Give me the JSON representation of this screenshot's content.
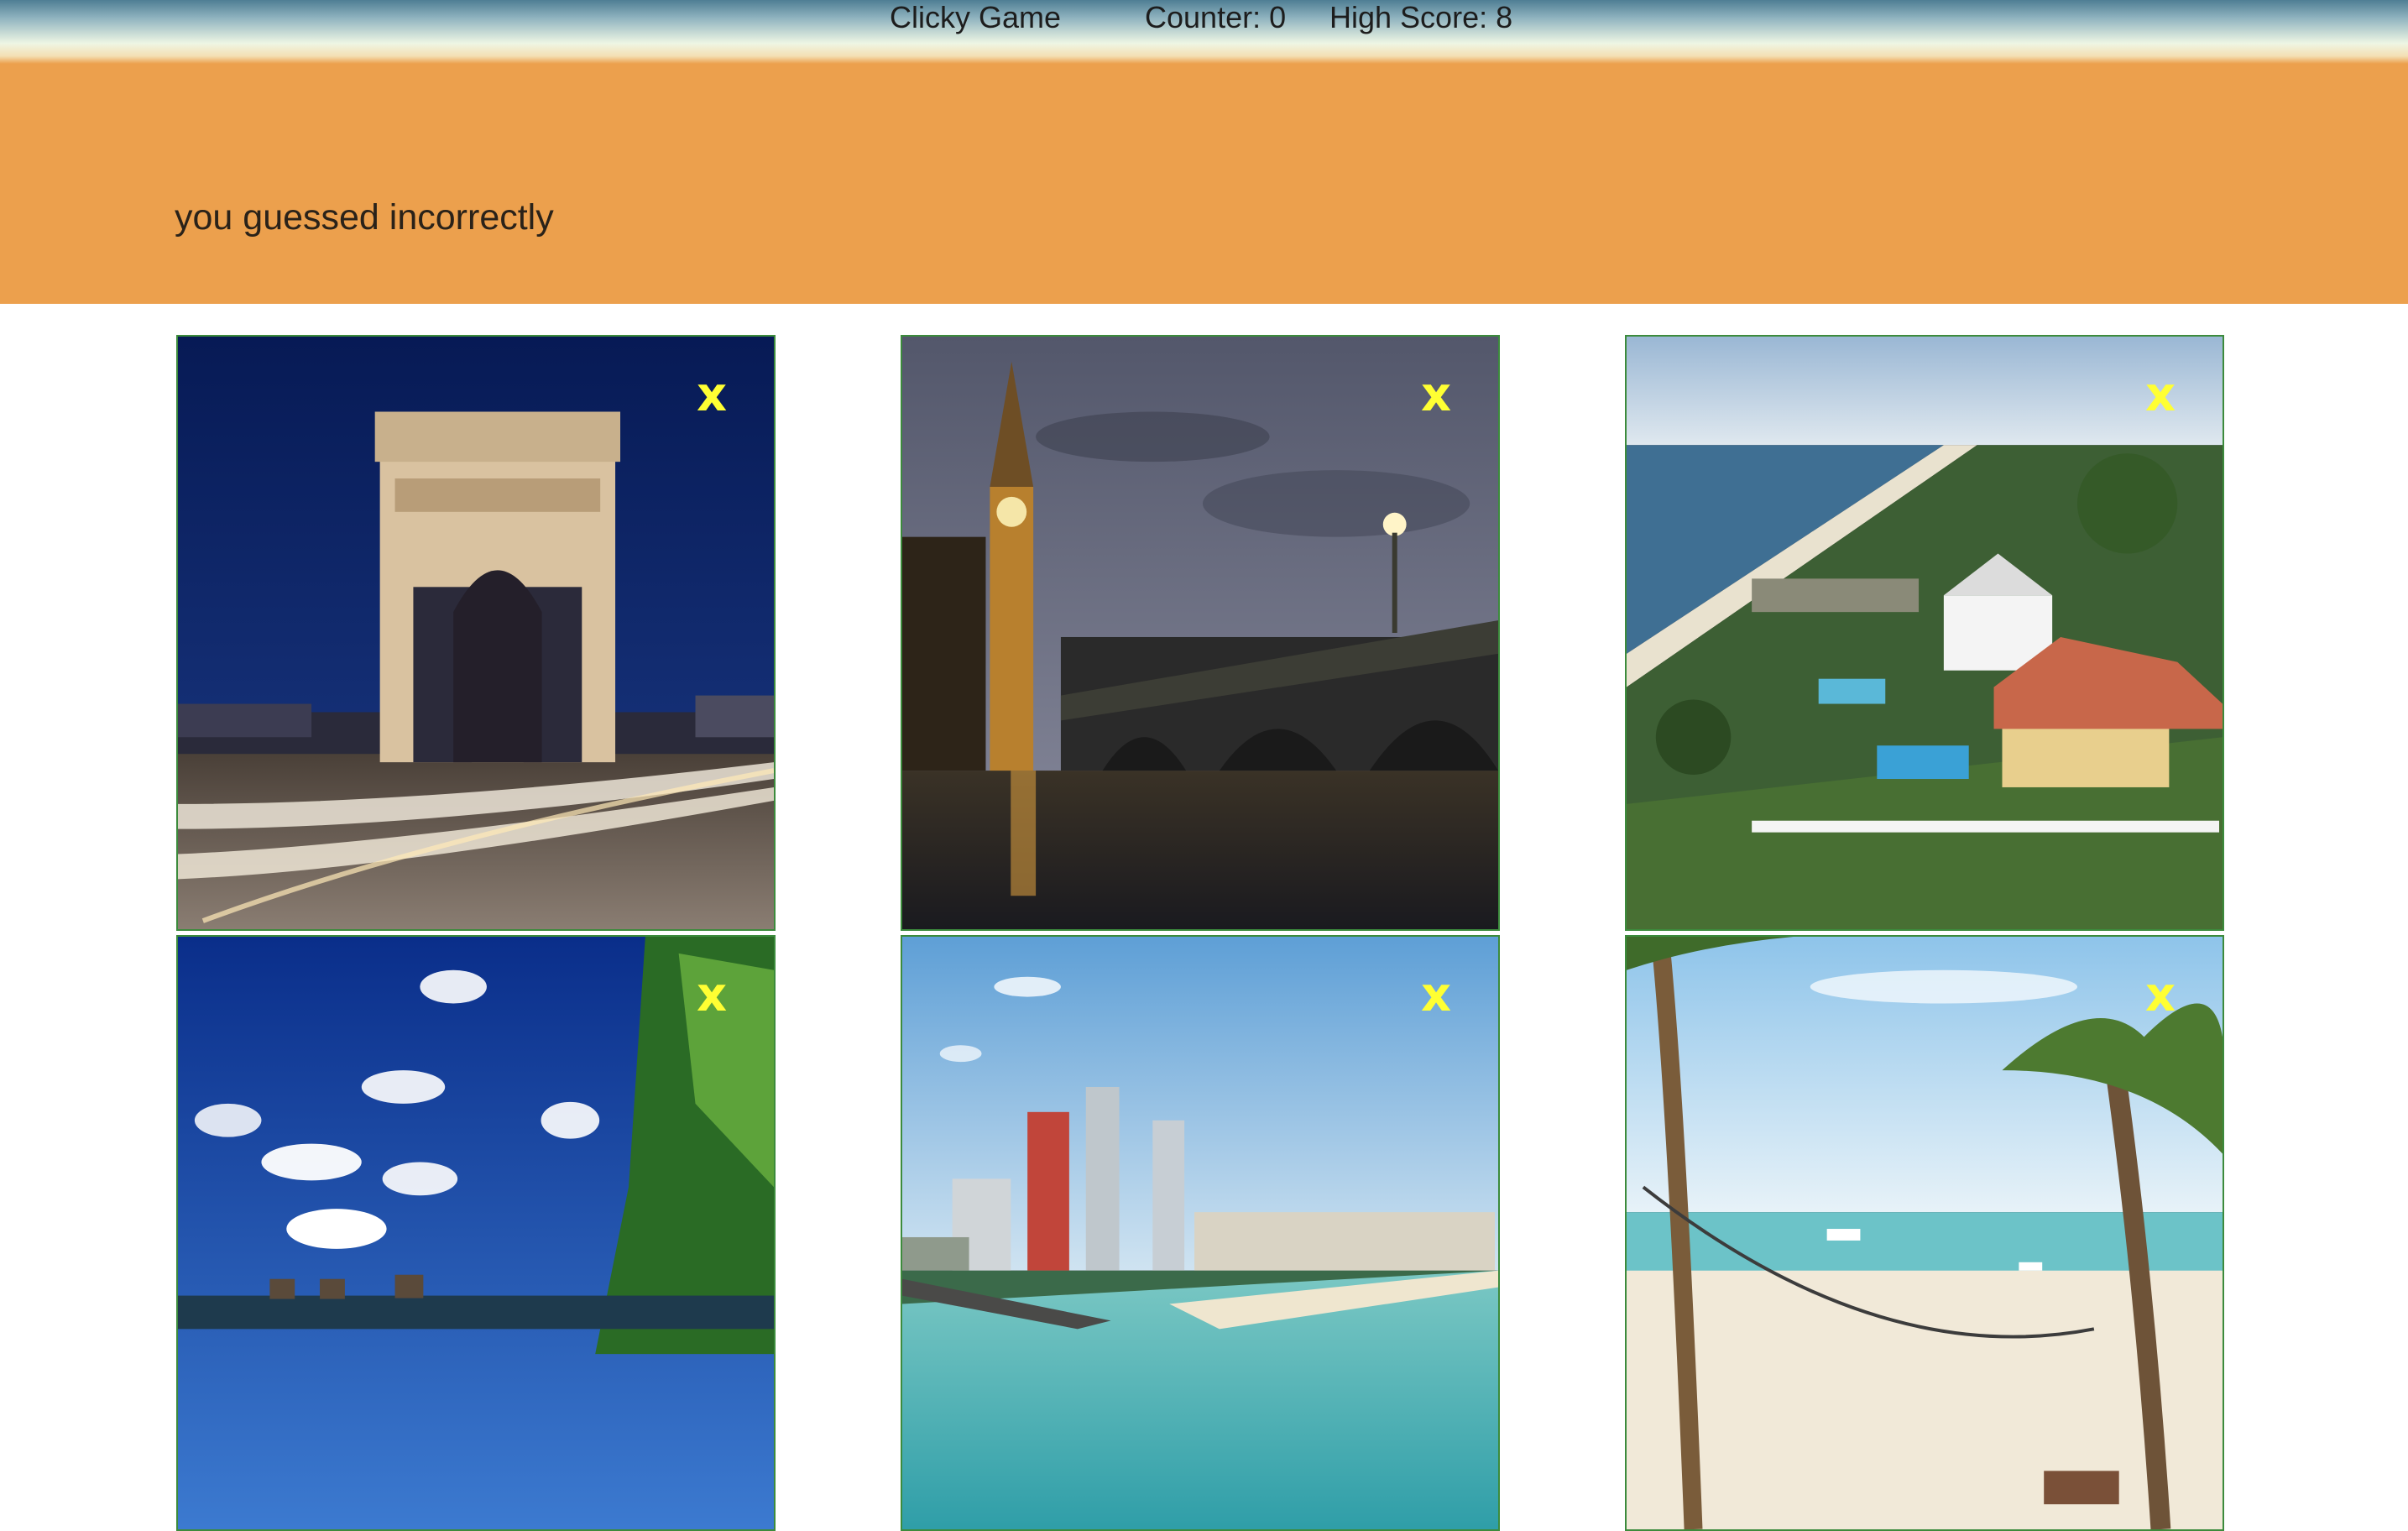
{
  "nav": {
    "title": "Clicky Game",
    "counter": "Counter: 0",
    "high_score": "High Score: 8"
  },
  "banner": {
    "message": "you guessed incorrectly"
  },
  "cards": [
    {
      "mark": "x",
      "scene": "arc-de-triomphe-night"
    },
    {
      "mark": "x",
      "scene": "big-ben-westminster-bridge"
    },
    {
      "mark": "x",
      "scene": "coastal-beach-resort-aerial"
    },
    {
      "mark": "x",
      "scene": "tropical-island-sky"
    },
    {
      "mark": "x",
      "scene": "miami-beach-skyline"
    },
    {
      "mark": "x",
      "scene": "palm-beach-hammock"
    }
  ],
  "colors": {
    "banner": "#eca04d",
    "card_border": "#3c8b3c",
    "mark": "#ffff33"
  }
}
